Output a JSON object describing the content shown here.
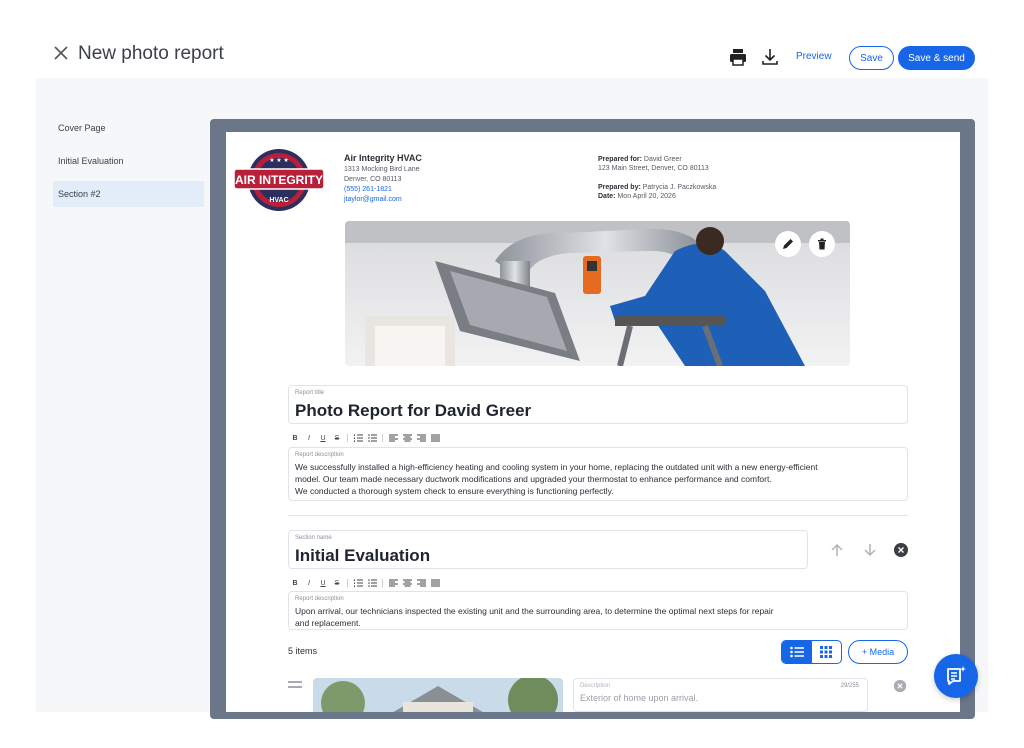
{
  "header": {
    "title": "New photo report",
    "preview_label": "Preview",
    "save_label": "Save",
    "save_send_label": "Save & send"
  },
  "sidebar": {
    "items": [
      {
        "label": "Cover Page"
      },
      {
        "label": "Initial Evaluation"
      },
      {
        "label": "Section #2"
      }
    ]
  },
  "company": {
    "logo_text": "AIR INTEGRITY",
    "logo_subtext": "HVAC",
    "name": "Air Integrity HVAC",
    "street": "1313 Mocking Bird Lane",
    "city": "Denver, CO 80113",
    "phone": "(555) 261-1821",
    "email": "jtaylor@gmail.com"
  },
  "prepared": {
    "for_label": "Prepared for:",
    "for_name": "David Greer",
    "for_address": "123 Main Street, Denver, CO 80113",
    "by_label": "Prepared by:",
    "by_name": "Patrycia J. Paczkowska",
    "date_label": "Date:",
    "date_value": "Mon April 20, 2026"
  },
  "report": {
    "title_label": "Report title",
    "title_value": "Photo Report for David Greer",
    "desc_label": "Report description",
    "desc_line1": "We successfully installed a high-efficiency heating and cooling system in your home, replacing the outdated unit with a new energy-efficient",
    "desc_line2": "model. Our team made necessary ductwork modifications and upgraded your thermostat to enhance performance and comfort.",
    "desc_line3": "We conducted a thorough system check to ensure everything is functioning perfectly."
  },
  "toolbar": {
    "bold": "B",
    "italic": "I",
    "underline": "U",
    "strike": "S"
  },
  "section": {
    "name_label": "Section name",
    "name_value": "Initial Evaluation",
    "desc_label": "Report description",
    "desc_line1": "Upon arrival, our technicians inspected the existing unit and the surrounding area, to determine the optimal next steps for repair",
    "desc_line2": "and replacement.",
    "items_count": "5 items",
    "media_label": "+ Media"
  },
  "item": {
    "desc_label": "Description",
    "desc_value": "Exterior of home upon arrival.",
    "char_count": "29/255"
  },
  "colors": {
    "accent": "#1766e8",
    "frame": "#6b7689",
    "logo_red": "#b8203a",
    "logo_navy": "#2b2f5e"
  }
}
